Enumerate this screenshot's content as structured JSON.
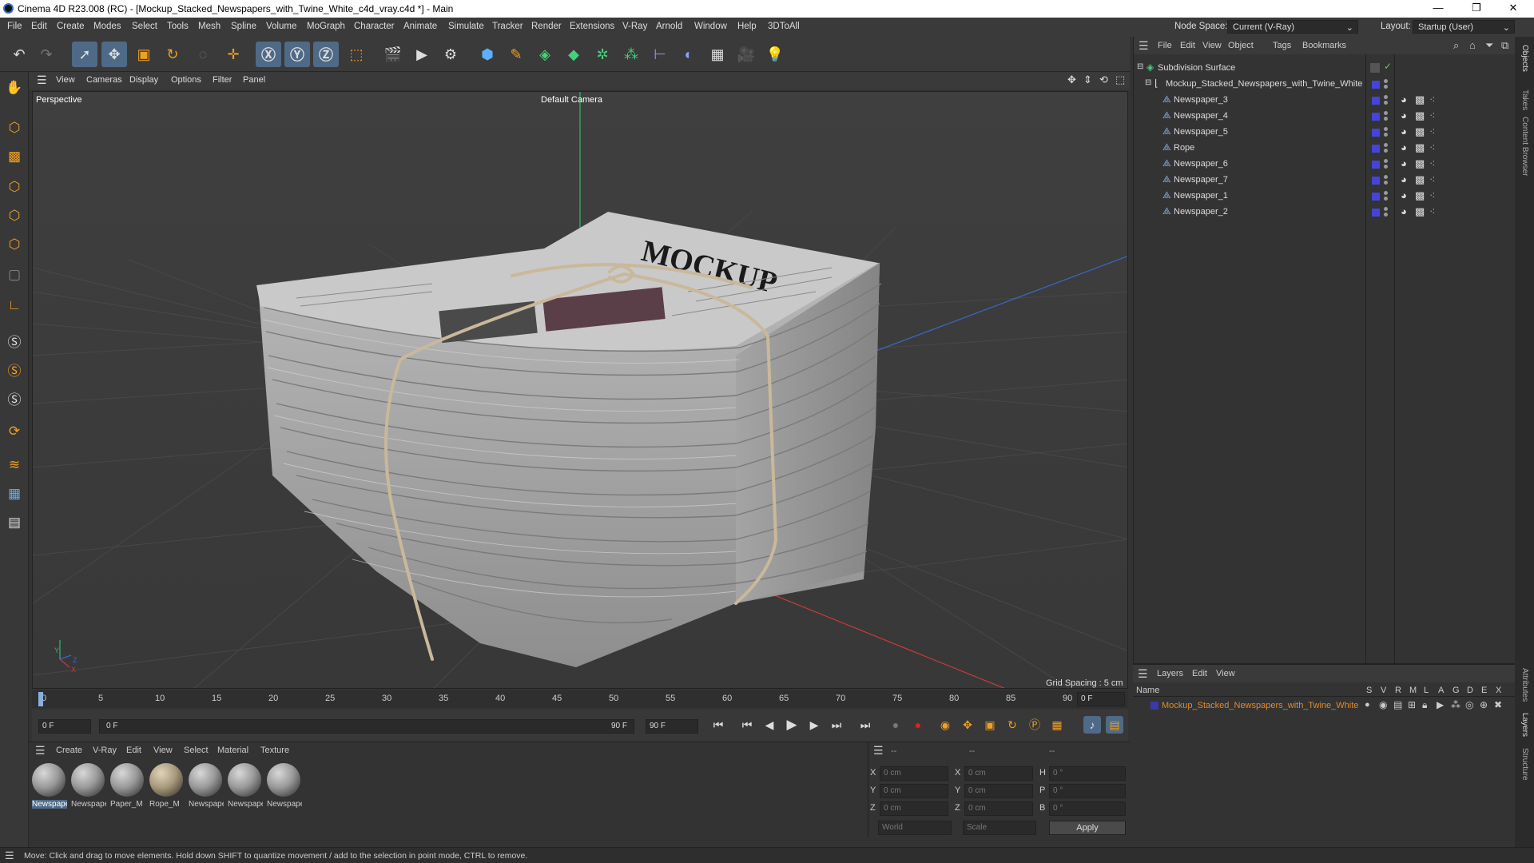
{
  "window": {
    "title": "Cinema 4D R23.008 (RC) - [Mockup_Stacked_Newspapers_with_Twine_White_c4d_vray.c4d *] - Main",
    "minimize": "—",
    "maximize": "❐",
    "close": "✕"
  },
  "menubar": {
    "items": [
      "File",
      "Edit",
      "Create",
      "Modes",
      "Select",
      "Tools",
      "Mesh",
      "Spline",
      "Volume",
      "MoGraph",
      "Character",
      "Animate",
      "Simulate",
      "Tracker",
      "Render",
      "Extensions",
      "V-Ray",
      "Arnold",
      "Window",
      "Help",
      "3DToAll"
    ],
    "node_space_label": "Node Space:",
    "node_space_value": "Current (V-Ray)",
    "layout_label": "Layout:",
    "layout_value": "Startup (User)"
  },
  "viewport": {
    "menu": [
      "View",
      "Cameras",
      "Display",
      "Options",
      "Filter",
      "Panel"
    ],
    "name": "Perspective",
    "camera": "Default Camera",
    "grid_spacing": "Grid Spacing : 5 cm",
    "axis_labels": [
      "Y",
      "Z",
      "X"
    ],
    "newspaper_headline": "MOCKUP"
  },
  "timeline": {
    "ticks": [
      "0",
      "5",
      "10",
      "15",
      "20",
      "25",
      "30",
      "35",
      "40",
      "45",
      "50",
      "55",
      "60",
      "65",
      "70",
      "75",
      "80",
      "85",
      "90"
    ],
    "current_frame": "0 F",
    "start_field": "0 F",
    "range_start": "0 F",
    "range_end": "90 F",
    "end_field": "90 F"
  },
  "materials": {
    "menu": [
      "Create",
      "V-Ray",
      "Edit",
      "View",
      "Select",
      "Material",
      "Texture"
    ],
    "items": [
      "Newspaper",
      "Newspaper",
      "Paper_M",
      "Rope_M",
      "Newspaper",
      "Newspaper",
      "Newspaper"
    ]
  },
  "coords": {
    "headers": [
      "--",
      "--",
      "--"
    ],
    "rows": [
      {
        "a": "X",
        "av": "0 cm",
        "b": "X",
        "bv": "0 cm",
        "c": "H",
        "cv": "0 °"
      },
      {
        "a": "Y",
        "av": "0 cm",
        "b": "Y",
        "bv": "0 cm",
        "c": "P",
        "cv": "0 °"
      },
      {
        "a": "Z",
        "av": "0 cm",
        "b": "Z",
        "bv": "0 cm",
        "c": "B",
        "cv": "0 °"
      }
    ],
    "world": "World",
    "scale": "Scale",
    "apply": "Apply"
  },
  "objects": {
    "menu": [
      "File",
      "Edit",
      "View",
      "Object",
      "Tags",
      "Bookmarks"
    ],
    "root": "Subdivision Surface",
    "group": "Mockup_Stacked_Newspapers_with_Twine_White",
    "children": [
      "Newspaper_3",
      "Newspaper_4",
      "Newspaper_5",
      "Rope",
      "Newspaper_6",
      "Newspaper_7",
      "Newspaper_1",
      "Newspaper_2"
    ]
  },
  "layers": {
    "menu": [
      "Layers",
      "Edit",
      "View"
    ],
    "name_header": "Name",
    "flag_headers": [
      "S",
      "V",
      "R",
      "M",
      "L",
      "A",
      "G",
      "D",
      "E",
      "X"
    ],
    "layer_name": "Mockup_Stacked_Newspapers_with_Twine_White",
    "layer_color": "#3a3aa8"
  },
  "right_tabs": [
    "Objects",
    "Takes",
    "Content Browser",
    "Attributes",
    "Layers",
    "Structure"
  ],
  "status": "Move: Click and drag to move elements. Hold down SHIFT to quantize movement / add to the selection in point mode, CTRL to remove.",
  "colors": {
    "accent": "#4e6a86",
    "layer_name": "#e08a2a",
    "check": "#5ad05a"
  }
}
